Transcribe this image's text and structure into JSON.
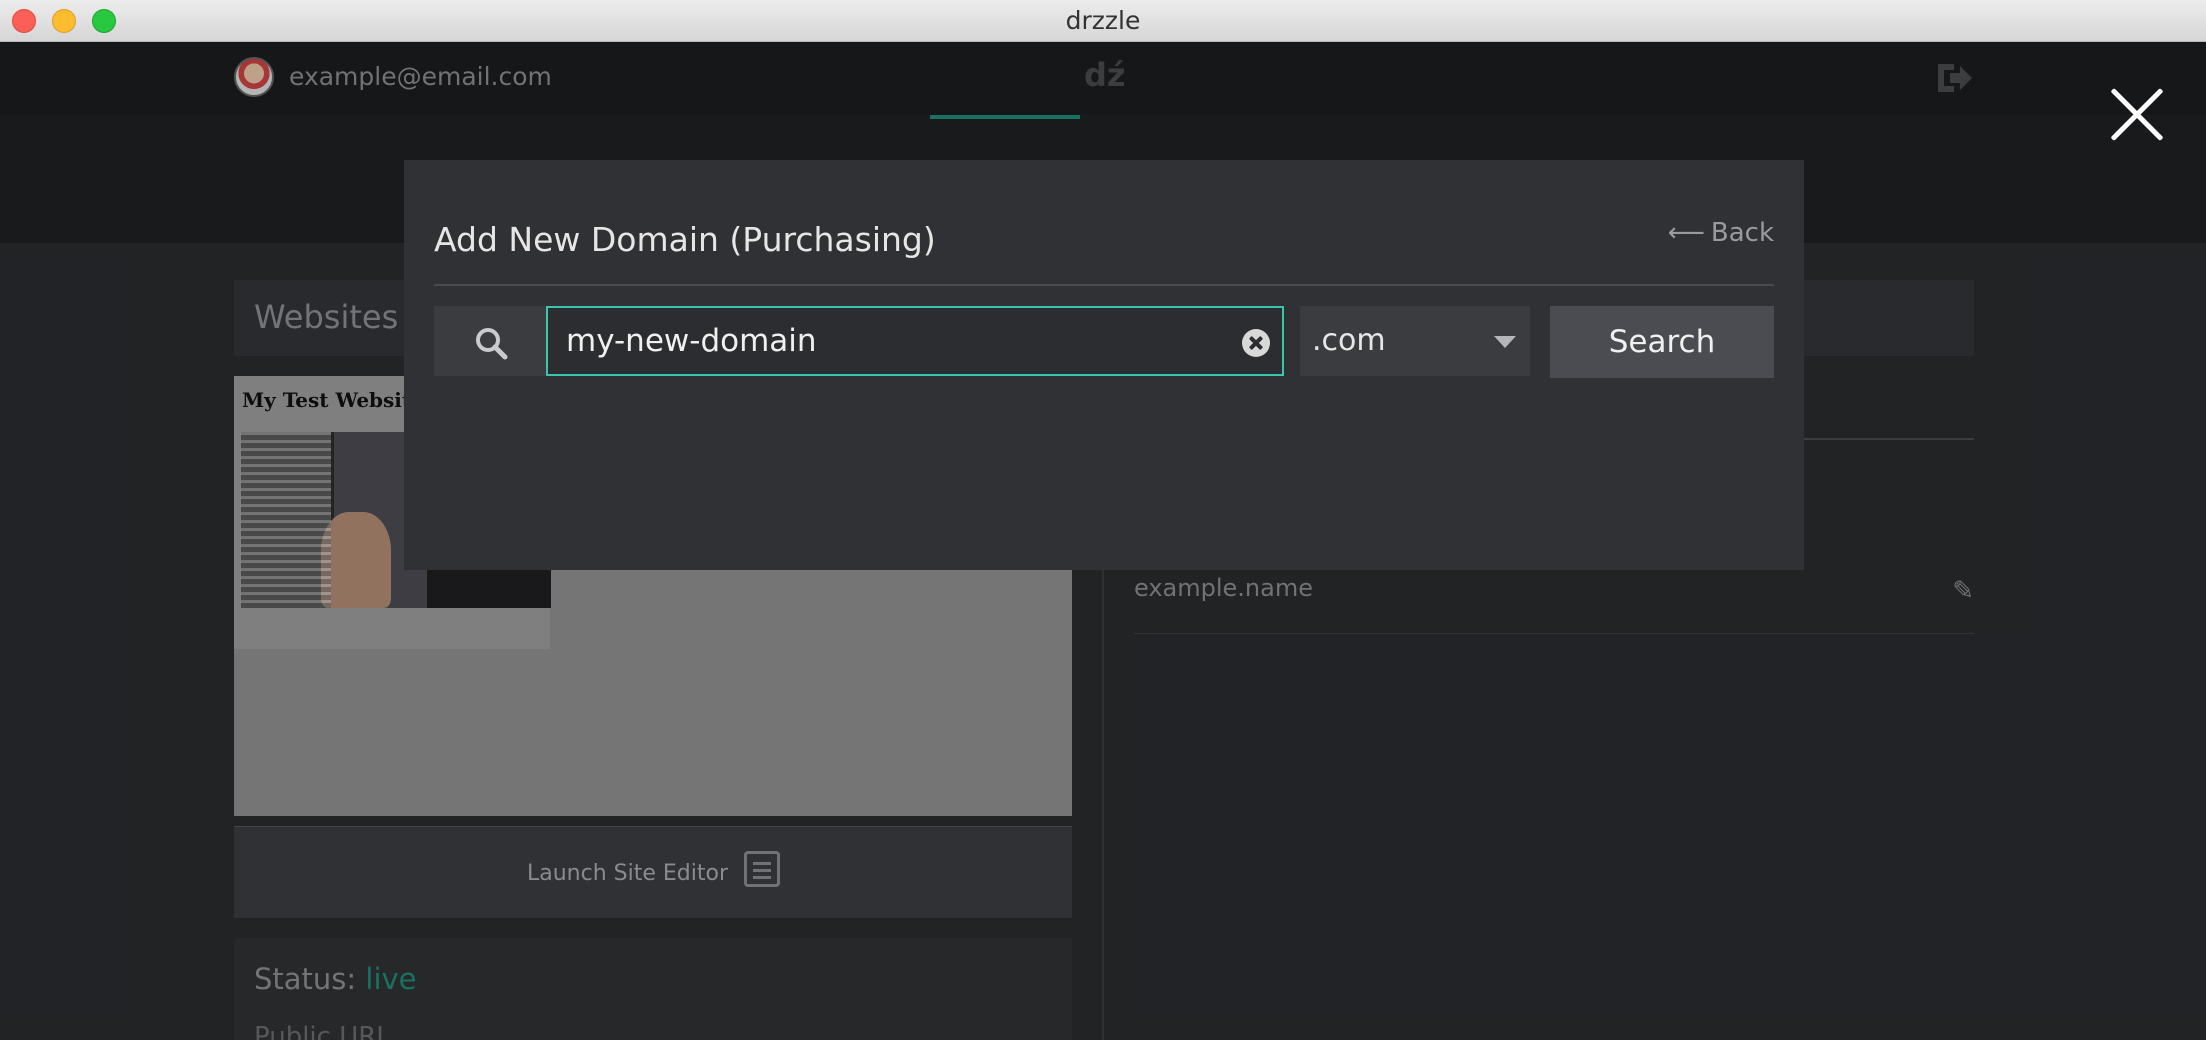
{
  "window": {
    "title": "drzzle"
  },
  "topbar": {
    "email": "example@email.com",
    "logo": "dź"
  },
  "websites_panel": {
    "heading": "Websites",
    "preview_title": "My Test Website",
    "launch_label": "Launch Site Editor",
    "status_label": "Status:",
    "status_value": "live",
    "public_url_label": "Public URL"
  },
  "domains_panel": {
    "domain_name": "example.name"
  },
  "modal": {
    "title": "Add New Domain (Purchasing)",
    "back_label": "Back",
    "search_value": "my-new-domain",
    "tld_selected": ".com",
    "search_button": "Search"
  },
  "colors": {
    "accent": "#3cc5ae",
    "live": "#1f8a78",
    "modal_bg": "#303134"
  }
}
